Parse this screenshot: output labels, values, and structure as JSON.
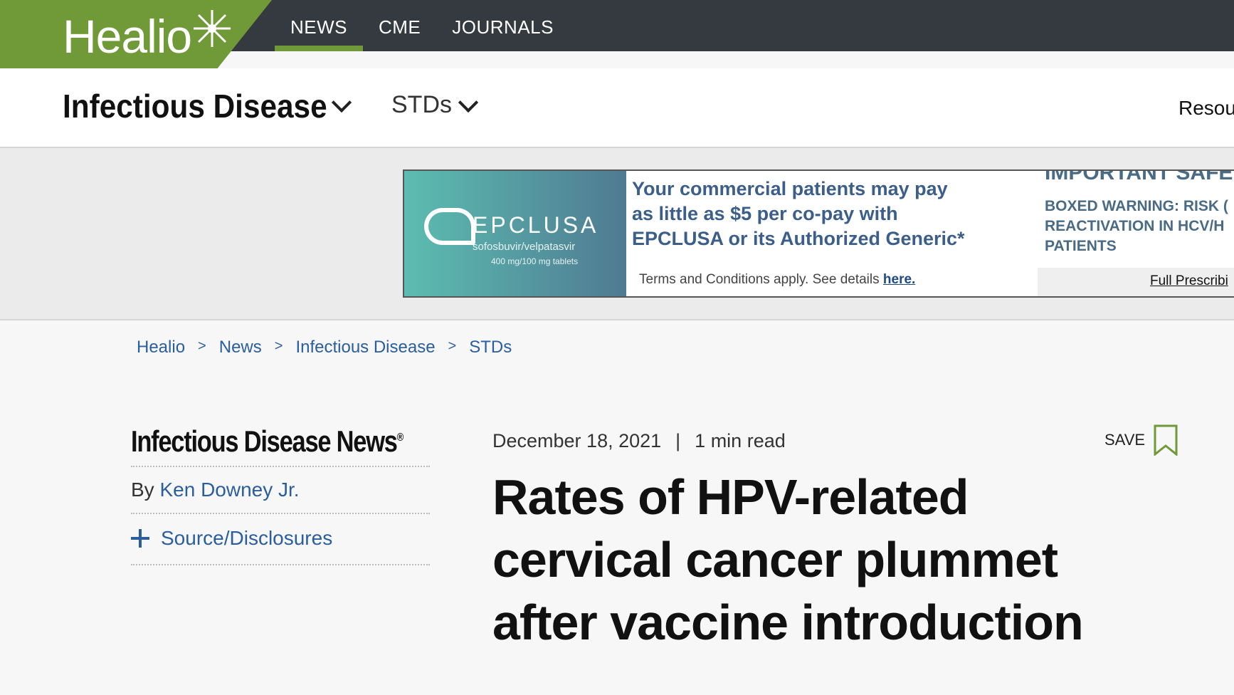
{
  "brand": {
    "logo_text": "Healio",
    "accent": "#6f9a37",
    "topbar_color": "#343a3f"
  },
  "main_nav": [
    {
      "label": "NEWS",
      "active": true
    },
    {
      "label": "CME",
      "active": false
    },
    {
      "label": "JOURNALS",
      "active": false
    }
  ],
  "sub_nav": {
    "section": "Infectious Disease",
    "topic": "STDs",
    "resources": "Resour"
  },
  "ad": {
    "brand_name": "EPCLUSA",
    "brand_sub": "sofosbuvir/velpatasvir",
    "brand_dose": "400 mg/100 mg tablets",
    "copy": "Your commercial patients may pay as little as $5 per co-pay with EPCLUSA or its Authorized Generic*",
    "terms": "Terms and Conditions apply. See details ",
    "terms_link": "here.",
    "safety_head": "IMPORTANT SAFE",
    "safety_body": "BOXED WARNING: RISK (\nREACTIVATION IN HCV/H\nPATIENTS",
    "safety_link": "Full Prescribi"
  },
  "breadcrumb": [
    "Healio",
    "News",
    "Infectious Disease",
    "STDs"
  ],
  "breadcrumb_sep": ">",
  "article": {
    "publication": "Infectious Disease News",
    "publication_mark": "®",
    "by": "By ",
    "author": "Ken Downey Jr.",
    "source_label": "Source/Disclosures",
    "date": "December 18, 2021",
    "meta_sep": "|",
    "read_time": "1 min read",
    "save_label": "SAVE",
    "headline": "Rates of HPV-related cervical cancer plummet after vaccine introduction"
  }
}
